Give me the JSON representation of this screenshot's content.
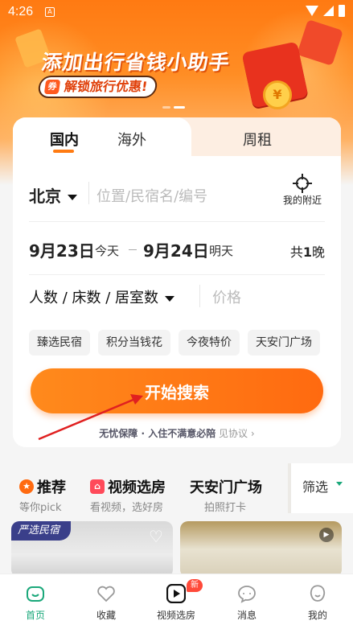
{
  "status_bar": {
    "time": "4:26",
    "app_badge": "A"
  },
  "banner": {
    "title": "添加出行省钱小助手",
    "subtitle": "解锁旅行优惠!",
    "coin_symbol": "¥",
    "tag_icon": "ticket-icon"
  },
  "search": {
    "tabs": [
      "国内",
      "海外",
      "周租"
    ],
    "city": "北京",
    "location_placeholder": "位置/民宿名/编号",
    "nearby_label": "我的附近",
    "checkin_date": "9月23日",
    "checkin_day": "今天",
    "checkout_date": "9月24日",
    "checkout_day": "明天",
    "nights_prefix": "共",
    "nights_count": "1",
    "nights_suffix": "晚",
    "guests_label": "人数 / 床数 / 居室数",
    "price_placeholder": "价格",
    "chips": [
      "臻选民宿",
      "积分当钱花",
      "今夜特价",
      "天安门广场"
    ],
    "search_button": "开始搜索",
    "guarantee_bold": "无忧保障 · 入住不满意必陪",
    "guarantee_link": "见协议",
    "guarantee_chevron": "›"
  },
  "categories": [
    {
      "title": "推荐",
      "sub": "等你pick",
      "icon": "star-icon"
    },
    {
      "title": "视频选房",
      "sub": "看视频，选好房",
      "icon": "video-house-icon"
    },
    {
      "title": "天安门广场",
      "sub": "拍照打卡",
      "icon": ""
    }
  ],
  "filter_label": "筛选",
  "listings": {
    "badge": "严选民宿",
    "heart_glyph": "♡",
    "play_glyph": "▶"
  },
  "bottom_nav": [
    {
      "label": "首页",
      "icon": "home-icon",
      "active": true
    },
    {
      "label": "收藏",
      "icon": "heart-icon",
      "active": false
    },
    {
      "label": "视频选房",
      "icon": "video-play-icon",
      "active": false
    },
    {
      "label": "消息",
      "icon": "message-icon",
      "active": false
    },
    {
      "label": "我的",
      "icon": "profile-icon",
      "active": false
    }
  ],
  "nav_new_badge": "新",
  "colors": {
    "accent": "#ff7b12",
    "green": "#1aa87a",
    "annotation_arrow": "#e02020"
  }
}
